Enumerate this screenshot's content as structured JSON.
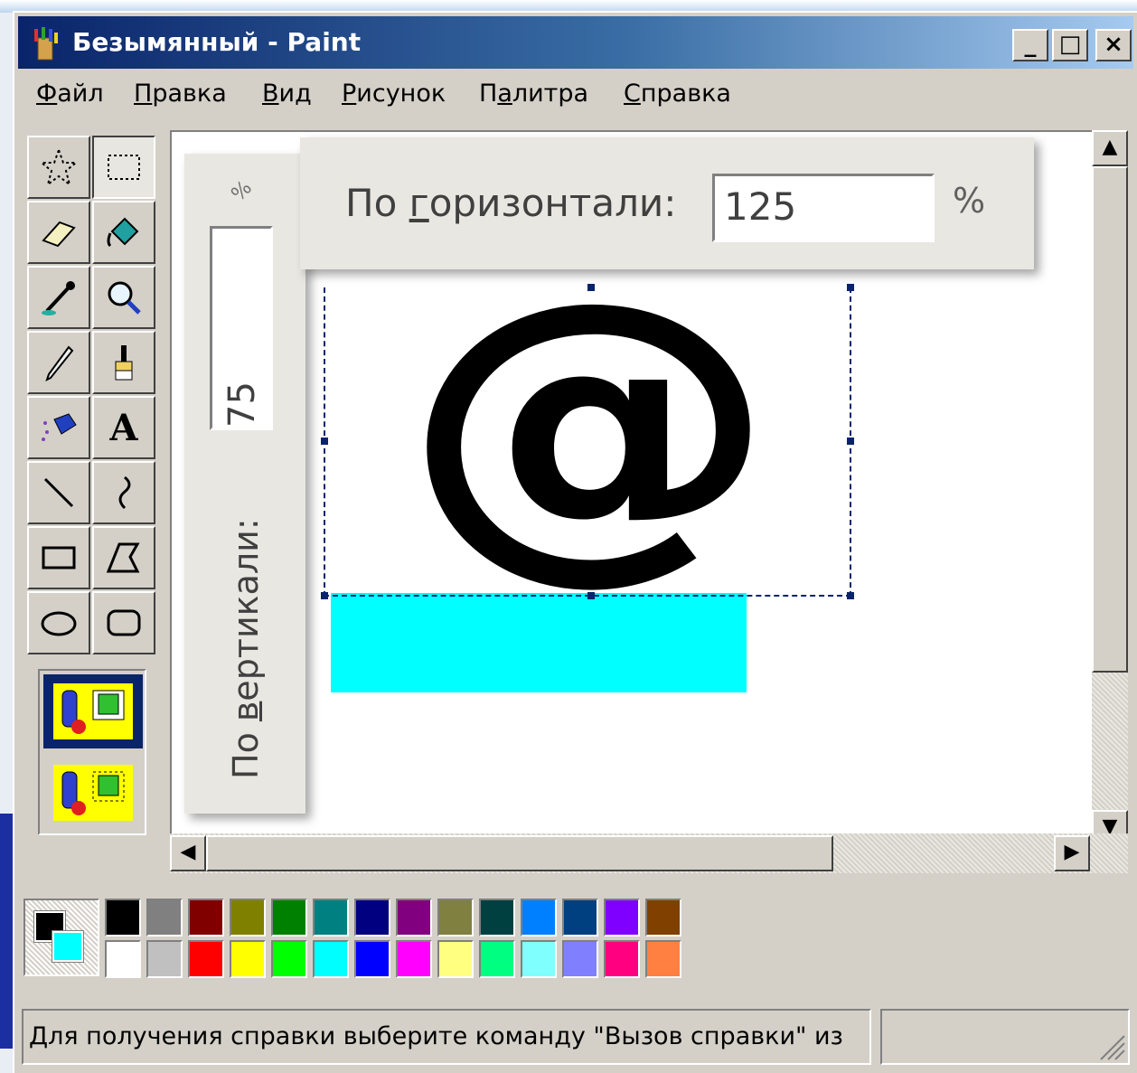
{
  "window": {
    "title": "Безымянный - Paint",
    "buttons": {
      "minimize": "_",
      "maximize": "□",
      "close": "×"
    }
  },
  "menu": [
    {
      "label_pre": "",
      "label_ul": "Ф",
      "label_post": "айл"
    },
    {
      "label_pre": "",
      "label_ul": "П",
      "label_post": "равка"
    },
    {
      "label_pre": "",
      "label_ul": "В",
      "label_post": "ид"
    },
    {
      "label_pre": "",
      "label_ul": "Р",
      "label_post": "исунок"
    },
    {
      "label_pre": "П",
      "label_ul": "а",
      "label_post": "литра"
    },
    {
      "label_pre": "",
      "label_ul": "С",
      "label_post": "правка"
    }
  ],
  "tools": [
    {
      "name": "free-select",
      "icon": "star-select-icon"
    },
    {
      "name": "rect-select",
      "icon": "rect-select-icon"
    },
    {
      "name": "eraser",
      "icon": "eraser-icon"
    },
    {
      "name": "fill",
      "icon": "paint-bucket-icon"
    },
    {
      "name": "pick-color",
      "icon": "eyedropper-icon"
    },
    {
      "name": "magnifier",
      "icon": "magnifier-icon"
    },
    {
      "name": "pencil",
      "icon": "pencil-icon"
    },
    {
      "name": "brush",
      "icon": "brush-icon"
    },
    {
      "name": "airbrush",
      "icon": "airbrush-icon"
    },
    {
      "name": "text",
      "icon": "text-icon",
      "glyph": "A"
    },
    {
      "name": "line",
      "icon": "line-icon"
    },
    {
      "name": "curve",
      "icon": "curve-icon"
    },
    {
      "name": "rectangle",
      "icon": "rectangle-icon"
    },
    {
      "name": "polygon",
      "icon": "polygon-icon"
    },
    {
      "name": "ellipse",
      "icon": "ellipse-icon"
    },
    {
      "name": "rounded-rect",
      "icon": "rounded-rect-icon"
    }
  ],
  "dialog": {
    "horizontal_label_pre": "По ",
    "horizontal_label_ul": "г",
    "horizontal_label_post": "оризонтали:",
    "horizontal_value": "125",
    "horizontal_unit": "%",
    "vertical_label_pre": "По ",
    "vertical_label_ul": "в",
    "vertical_label_post": "ертикали:",
    "vertical_value": "75"
  },
  "canvas": {
    "glyph": "@",
    "cyan_color": "#00ffff"
  },
  "palette": {
    "foreground": "#000000",
    "background": "#00ffff",
    "row1": [
      "#000000",
      "#808080",
      "#800000",
      "#808000",
      "#008000",
      "#008080",
      "#000080",
      "#800080",
      "#808040",
      "#004040",
      "#0080ff",
      "#004080",
      "#8000ff",
      "#804000"
    ],
    "row2": [
      "#ffffff",
      "#c0c0c0",
      "#ff0000",
      "#ffff00",
      "#00ff00",
      "#00ffff",
      "#0000ff",
      "#ff00ff",
      "#ffff80",
      "#00ff80",
      "#80ffff",
      "#8080ff",
      "#ff0080",
      "#ff8040"
    ]
  },
  "status": {
    "text": "Для получения справки выберите команду \"Вызов справки\" из"
  }
}
